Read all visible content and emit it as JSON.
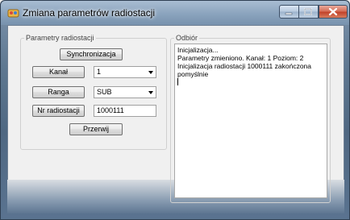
{
  "window": {
    "title": "Zmiana parametrów radiostacji"
  },
  "left_group": {
    "legend": "Parametry radiostacji",
    "sync_button": "Synchronizacja",
    "channel": {
      "label": "Kanał",
      "value": "1"
    },
    "range": {
      "label": "Ranga",
      "value": "SUB"
    },
    "radio_number": {
      "label": "Nr radiostacji",
      "value": "1000111"
    },
    "interrupt_button": "Przerwij"
  },
  "right_group": {
    "legend": "Odbiór",
    "log_lines": [
      "Inicjalizacja...",
      "Parametry zmieniono. Kanał: 1  Poziom: 2",
      "Inicjalizacja radiostacji 1000111 zakończona pomyślnie"
    ]
  }
}
